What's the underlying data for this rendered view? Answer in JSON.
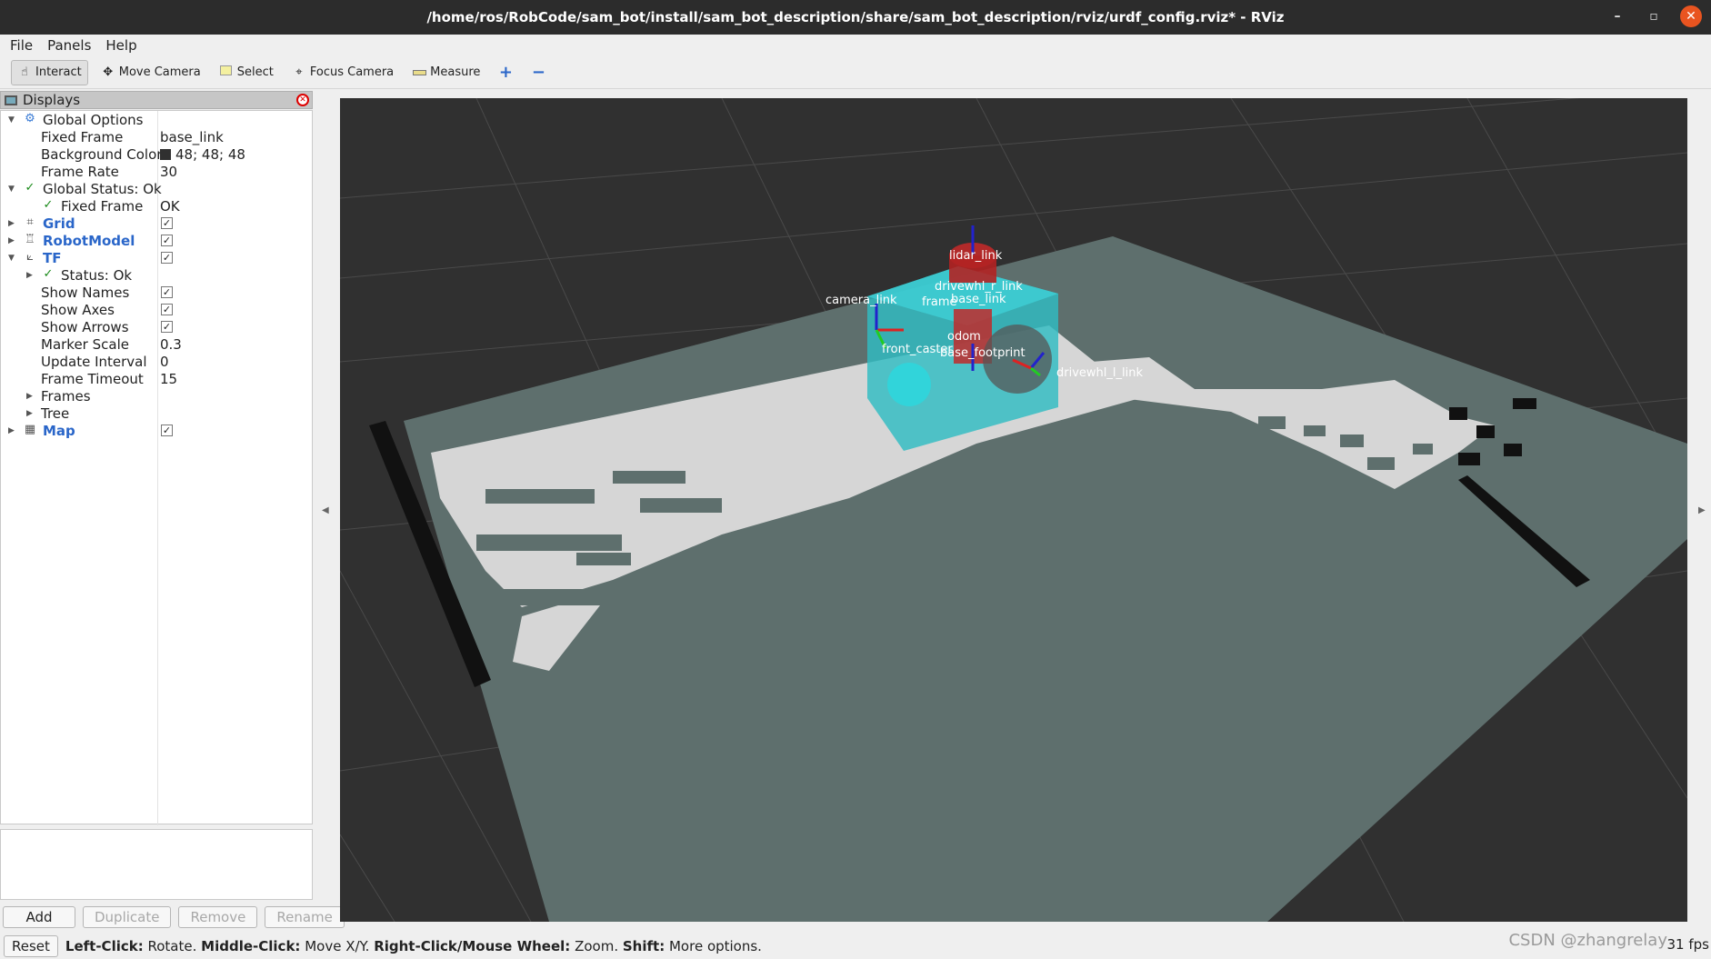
{
  "window": {
    "title": "/home/ros/RobCode/sam_bot/install/sam_bot_description/share/sam_bot_description/rviz/urdf_config.rviz* - RViz",
    "controls": {
      "minimize": "–",
      "maximize": "▫",
      "close": "✕"
    }
  },
  "menu": {
    "file": "File",
    "panels": "Panels",
    "help": "Help"
  },
  "toolbar": {
    "interact": "Interact",
    "move_camera": "Move Camera",
    "select": "Select",
    "focus_camera": "Focus Camera",
    "measure": "Measure",
    "add_tool": "+",
    "remove_tool": "−"
  },
  "displays_panel": {
    "title": "Displays",
    "rows": {
      "global_options": "Global Options",
      "fixed_frame_label": "Fixed Frame",
      "fixed_frame_value": "base_link",
      "background_color_label": "Background Color",
      "background_color_value": "48; 48; 48",
      "frame_rate_label": "Frame Rate",
      "frame_rate_value": "30",
      "global_status": "Global Status: Ok",
      "status_fixed_frame_label": "Fixed Frame",
      "status_fixed_frame_value": "OK",
      "grid": "Grid",
      "robot_model": "RobotModel",
      "tf": "TF",
      "tf_status": "Status: Ok",
      "show_names": "Show Names",
      "show_axes": "Show Axes",
      "show_arrows": "Show Arrows",
      "marker_scale_label": "Marker Scale",
      "marker_scale_value": "0.3",
      "update_interval_label": "Update Interval",
      "update_interval_value": "0",
      "frame_timeout_label": "Frame Timeout",
      "frame_timeout_value": "15",
      "frames": "Frames",
      "tree": "Tree",
      "map": "Map"
    },
    "buttons": {
      "add": "Add",
      "duplicate": "Duplicate",
      "remove": "Remove",
      "rename": "Rename"
    }
  },
  "scene_labels": {
    "lidar": "lidar_link",
    "drivewhl_r": "drivewhl_r_link",
    "base": "base_link",
    "camera": "camera_link",
    "odom_frame": "frame",
    "front_caster": "front_caster",
    "base_footprint": "base_footprint",
    "odom": "odom",
    "drivewhl_l": "drivewhl_l_link"
  },
  "statusbar": {
    "reset": "Reset",
    "left_click_key": "Left-Click:",
    "left_click_val": "Rotate.",
    "middle_click_key": "Middle-Click:",
    "middle_click_val": "Move X/Y.",
    "right_click_key": "Right-Click/Mouse Wheel:",
    "right_click_val": "Zoom.",
    "shift_key": "Shift:",
    "shift_val": "More options.",
    "fps": "31 fps"
  },
  "watermark": "CSDN @zhangrelay",
  "colors": {
    "viewport_bg": "#303030",
    "map_plane": "#5e6f6d",
    "free_cell": "#d6d6d6",
    "wall_cell": "#111111",
    "robot_body": "#2fbcc2",
    "lidar": "#c02a2a",
    "link_blue": "#2a66c9"
  }
}
